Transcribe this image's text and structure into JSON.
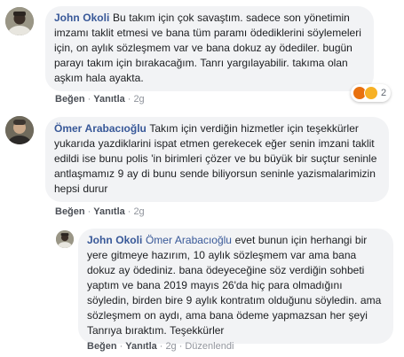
{
  "comments": [
    {
      "author": "John Okoli",
      "body": "Bu takım için çok savaştım. sadece son yönetimin imzamı taklit etmesi ve bana tüm paramı ödediklerini söylemeleri için, on aylık sözleşmem var ve bana dokuz ay ödediler. bugün parayı takım için bırakacağım. Tanrı yargılayabilir. takıma olan aşkım hala ayakta.",
      "like_label": "Beğen",
      "reply_label": "Yanıtla",
      "time": "2g",
      "reaction_count": "2",
      "reaction_icons": [
        "angry-reaction-icon",
        "wow-reaction-icon"
      ]
    },
    {
      "author": "Ömer Arabacıoğlu",
      "body": "Takım için verdiğin hizmetler için teşekkürler yukarıda yazdiklarini ispat etmen gerekecek eğer senin imzani taklit edildi ise bunu polis 'in birimleri çözer ve bu büyük bir suçtur seninle antlaşmamız 9 ay di bunu sende biliyorsun seninle yazismalarimizin hepsi durur",
      "like_label": "Beğen",
      "reply_label": "Yanıtla",
      "time": "2g"
    },
    {
      "author": "John Okoli",
      "mention": "Ömer Arabacıoğlu",
      "body": "evet bunun için herhangi bir yere gitmeye hazırım, 10 aylık sözleşmem var ama bana dokuz ay ödediniz. bana ödeyeceğine söz verdiğin sohbeti yaptım ve bana 2019 mayıs 26'da hiç para olmadığını söyledin, birden bire 9 aylık kontratım olduğunu söyledin. ama sözleşmem on aydı, ama bana ödeme yapmazsan her şeyi Tanrıya bıraktım. Teşekkürler",
      "like_label": "Beğen",
      "reply_label": "Yanıtla",
      "time": "2g",
      "edited_label": "Düzenlendi"
    }
  ],
  "colors": {
    "bubble": "#f2f3f5",
    "author": "#385898",
    "angry": "#e9710f",
    "wow": "#f7b125"
  }
}
